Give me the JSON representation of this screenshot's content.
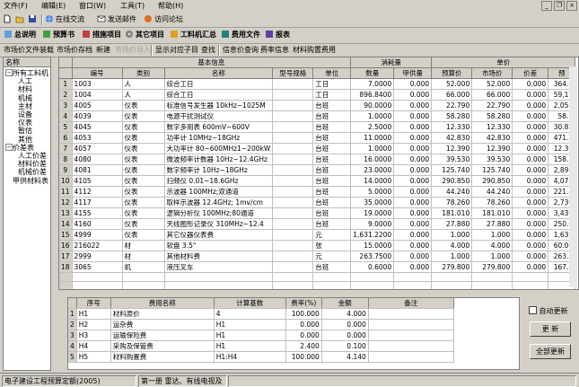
{
  "menubar": {
    "items": [
      "文件(F)",
      "编辑(E)",
      "窗口(W)",
      "工具(T)",
      "帮助(H)"
    ]
  },
  "toolbar1": {
    "online": "在线交流",
    "mail": "发送邮件",
    "forum": "访问论坛"
  },
  "toolbar2": {
    "items": [
      "总说明",
      "预算书",
      "措施项目",
      "其它项目",
      "工料机汇总",
      "费用文件",
      "报表"
    ]
  },
  "toolbar3": {
    "items": [
      "市场价文件装载",
      "市场价存档",
      "新建",
      "市场价导入",
      "显示对应子目",
      "查找",
      "信息价查询",
      "费率信息",
      "材料购置费用"
    ]
  },
  "tree": {
    "header": "名称",
    "nodes": [
      {
        "label": "所有工料机",
        "level": 0,
        "expander": "−"
      },
      {
        "label": "人工",
        "level": 1
      },
      {
        "label": "材料",
        "level": 1
      },
      {
        "label": "机械",
        "level": 1
      },
      {
        "label": "主材",
        "level": 1
      },
      {
        "label": "设备",
        "level": 1
      },
      {
        "label": "仪表",
        "level": 1
      },
      {
        "label": "暂估",
        "level": 1
      },
      {
        "label": "其他",
        "level": 1
      },
      {
        "label": "价差表",
        "level": 0,
        "expander": "−"
      },
      {
        "label": "人工价差",
        "level": 1
      },
      {
        "label": "材料价差",
        "level": 1
      },
      {
        "label": "机械价差",
        "level": 1
      },
      {
        "label": "甲供材料表",
        "level": 0
      }
    ]
  },
  "grid": {
    "group_headers": {
      "basic": "基本信息",
      "consumption": "消耗量",
      "price": "单价"
    },
    "columns": [
      "编号",
      "类别",
      "名称",
      "型号规格",
      "单位",
      "数量",
      "甲供量",
      "预算价",
      "市场价",
      "价差",
      "预"
    ],
    "rows": [
      {
        "idx": "1",
        "code": "1003",
        "cat": "人",
        "name": "综合工日",
        "spec": "",
        "unit": "工日",
        "qty": "7.0000",
        "supplied": "0.000",
        "budget": "52.000",
        "market": "52.000",
        "diff": "0.000",
        "pre": "364.0"
      },
      {
        "idx": "2",
        "code": "1004",
        "cat": "人",
        "name": "综合工日",
        "spec": "",
        "unit": "工日",
        "qty": "896.8400",
        "supplied": "0.000",
        "budget": "66.000",
        "market": "66.000",
        "diff": "0.000",
        "pre": "59,19"
      },
      {
        "idx": "3",
        "code": "4005",
        "cat": "仪表",
        "name": "标准信号发生器 10kHz~1025M",
        "spec": "",
        "unit": "台班",
        "qty": "90.0000",
        "supplied": "0.000",
        "budget": "22.790",
        "market": "22.790",
        "diff": "0.000",
        "pre": "2,051"
      },
      {
        "idx": "4",
        "code": "4039",
        "cat": "仪表",
        "name": "电源干扰测试仪",
        "spec": "",
        "unit": "台班",
        "qty": "1.0000",
        "supplied": "0.000",
        "budget": "58.280",
        "market": "58.280",
        "diff": "0.000",
        "pre": "58.2"
      },
      {
        "idx": "5",
        "code": "4045",
        "cat": "仪表",
        "name": "数字多用表 600mV~600V",
        "spec": "",
        "unit": "台班",
        "qty": "2.5000",
        "supplied": "0.000",
        "budget": "12.330",
        "market": "12.330",
        "diff": "0.000",
        "pre": "30.82"
      },
      {
        "idx": "6",
        "code": "4053",
        "cat": "仪表",
        "name": "功率计 10MHz~18GHz",
        "spec": "",
        "unit": "台班",
        "qty": "11.0000",
        "supplied": "0.000",
        "budget": "42.830",
        "market": "42.830",
        "diff": "0.000",
        "pre": "471.1"
      },
      {
        "idx": "7",
        "code": "4057",
        "cat": "仪表",
        "name": "大功率计 80~600MHz1~200kW",
        "spec": "",
        "unit": "台班",
        "qty": "1.0000",
        "supplied": "0.000",
        "budget": "12.390",
        "market": "12.390",
        "diff": "0.000",
        "pre": "12.39"
      },
      {
        "idx": "8",
        "code": "4080",
        "cat": "仪表",
        "name": "微波频率计数器 10Hz~12.4GHz",
        "spec": "",
        "unit": "台班",
        "qty": "16.0000",
        "supplied": "0.000",
        "budget": "39.530",
        "market": "39.530",
        "diff": "0.000",
        "pre": "158.1"
      },
      {
        "idx": "9",
        "code": "4081",
        "cat": "仪表",
        "name": "数字频率计 10Hz~18GHz",
        "spec": "",
        "unit": "台班",
        "qty": "23.0000",
        "supplied": "0.000",
        "budget": "125.740",
        "market": "125.740",
        "diff": "0.000",
        "pre": "2,892"
      },
      {
        "idx": "10",
        "code": "4105",
        "cat": "仪表",
        "name": "扫频仪 0.01~18.6GHz",
        "spec": "",
        "unit": "台班",
        "qty": "14.0000",
        "supplied": "0.000",
        "budget": "290.850",
        "market": "290.850",
        "diff": "0.000",
        "pre": "4,071"
      },
      {
        "idx": "11",
        "code": "4112",
        "cat": "仪表",
        "name": "示波器 100MHz;双通道",
        "spec": "",
        "unit": "台班",
        "qty": "5.0000",
        "supplied": "0.000",
        "budget": "44.240",
        "market": "44.240",
        "diff": "0.000",
        "pre": "221.2"
      },
      {
        "idx": "12",
        "code": "4117",
        "cat": "仪表",
        "name": "取样示波器 12.4GHz; 1mv/cm",
        "spec": "",
        "unit": "台班",
        "qty": "35.0000",
        "supplied": "0.000",
        "budget": "78.260",
        "market": "78.260",
        "diff": "0.000",
        "pre": "2,739"
      },
      {
        "idx": "13",
        "code": "4155",
        "cat": "仪表",
        "name": "逻辑分析仪 100MHz;80通道",
        "spec": "",
        "unit": "台班",
        "qty": "19.0000",
        "supplied": "0.000",
        "budget": "181.010",
        "market": "181.010",
        "diff": "0.000",
        "pre": "3,439"
      },
      {
        "idx": "14",
        "code": "4160",
        "cat": "仪表",
        "name": "天线图形记录仪 310MHz~12.4",
        "spec": "",
        "unit": "台班",
        "qty": "9.0000",
        "supplied": "0.000",
        "budget": "27.880",
        "market": "27.880",
        "diff": "0.000",
        "pre": "250.9"
      },
      {
        "idx": "15",
        "code": "4999",
        "cat": "仪表",
        "name": "其它仪器仪表费",
        "spec": "",
        "unit": "元",
        "qty": "1,631.2200",
        "supplied": "0.000",
        "budget": "1.000",
        "market": "1.000",
        "diff": "0.000",
        "pre": "1,631"
      },
      {
        "idx": "16",
        "code": "216022",
        "cat": "材",
        "name": "软盘 3.5\"",
        "spec": "",
        "unit": "张",
        "qty": "15.0000",
        "supplied": "0.000",
        "budget": "4.000",
        "market": "4.000",
        "diff": "0.000",
        "pre": "60.00"
      },
      {
        "idx": "17",
        "code": "2999",
        "cat": "材",
        "name": "其他材料费",
        "spec": "",
        "unit": "元",
        "qty": "263.7500",
        "supplied": "0.000",
        "budget": "1.000",
        "market": "1.000",
        "diff": "0.000",
        "pre": "263.7"
      },
      {
        "idx": "18",
        "code": "3065",
        "cat": "机",
        "name": "液压叉车",
        "spec": "",
        "unit": "台班",
        "qty": "0.6000",
        "supplied": "0.000",
        "budget": "279.800",
        "market": "279.800",
        "diff": "0.000",
        "pre": "167.8"
      }
    ]
  },
  "fees": {
    "columns": [
      "序号",
      "费用名称",
      "计算基数",
      "费率(%)",
      "金额",
      "备注"
    ],
    "rows": [
      {
        "idx": "1",
        "no": "H1",
        "name": "材料原价",
        "base": "4",
        "rate": "100.000",
        "amount": "4.000",
        "note": ""
      },
      {
        "idx": "2",
        "no": "H2",
        "name": "运杂费",
        "base": "H1",
        "rate": "0.000",
        "amount": "0.000",
        "note": ""
      },
      {
        "idx": "3",
        "no": "H3",
        "name": "运输保险费",
        "base": "H1",
        "rate": "0.000",
        "amount": "0.000",
        "note": ""
      },
      {
        "idx": "4",
        "no": "H4",
        "name": "采购及保管费",
        "base": "H1",
        "rate": "2.400",
        "amount": "0.100",
        "note": ""
      },
      {
        "idx": "5",
        "no": "H5",
        "name": "材料购置费",
        "base": "H1:H4",
        "rate": "100.000",
        "amount": "4.140",
        "note": ""
      }
    ]
  },
  "side": {
    "auto_update": "自动更新",
    "update": "更 新",
    "update_all": "全部更新"
  },
  "status": {
    "left": "电子建设工程预算定额(2005)",
    "mid": "第一册 雷达、有线电视及"
  }
}
